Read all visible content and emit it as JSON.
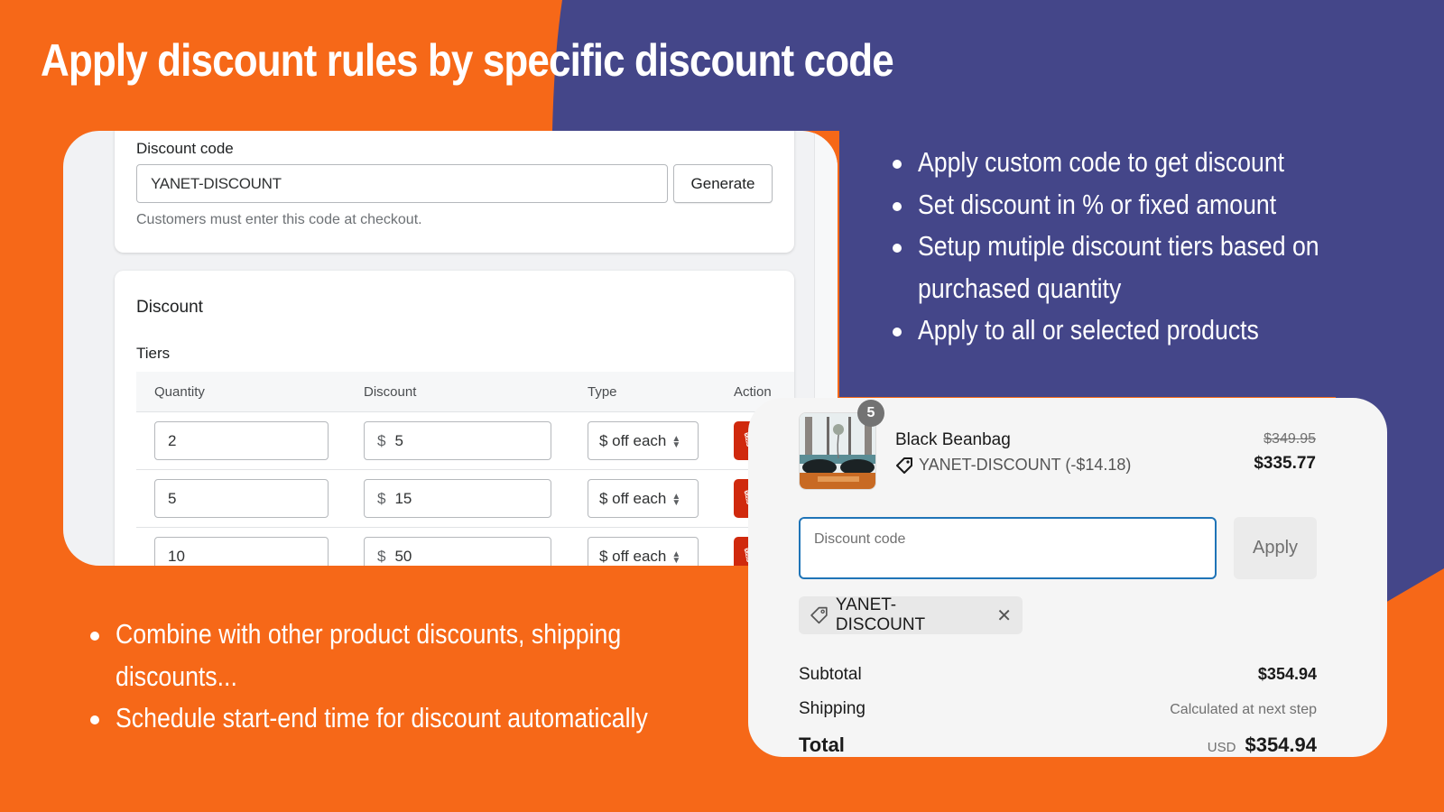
{
  "headline": "Apply discount rules by specific discount code",
  "colors": {
    "orange": "#f66818",
    "purple": "#444689",
    "danger": "#d0290d",
    "focus_blue": "#1f74b7"
  },
  "admin": {
    "code_card": {
      "label": "Discount code",
      "value": "YANET-DISCOUNT",
      "generate_label": "Generate",
      "helptext": "Customers must enter this code at checkout."
    },
    "discount_card": {
      "title": "Discount",
      "tiers_label": "Tiers",
      "columns": [
        "Quantity",
        "Discount",
        "Type",
        "Action"
      ],
      "rows": [
        {
          "quantity": "2",
          "currency": "$",
          "discount": "5",
          "type": "$ off each",
          "action_icon": "trash-icon"
        },
        {
          "quantity": "5",
          "currency": "$",
          "discount": "15",
          "type": "$ off each",
          "action_icon": "trash-icon"
        },
        {
          "quantity": "10",
          "currency": "$",
          "discount": "50",
          "type": "$ off each",
          "action_icon": "trash-icon"
        }
      ]
    }
  },
  "features_right": [
    "Apply custom code to get discount",
    "Set discount in % or fixed amount",
    "Setup mutiple discount tiers based on purchased quantity",
    "Apply to all or selected products"
  ],
  "features_left": [
    "Combine with other product discounts, shipping discounts...",
    "Schedule start-end time for discount automatically"
  ],
  "checkout": {
    "product": {
      "name": "Black Beanbag",
      "quantity_badge": "5",
      "code_line": "YANET-DISCOUNT (-$14.18)",
      "tag_icon": "tag-icon",
      "price_original": "$349.95",
      "price_discounted": "$335.77"
    },
    "discount_input_placeholder": "Discount code",
    "apply_label": "Apply",
    "applied_code": "YANET-DISCOUNT",
    "subtotal_label": "Subtotal",
    "subtotal_value": "$354.94",
    "shipping_label": "Shipping",
    "shipping_value": "Calculated at next step",
    "total_label": "Total",
    "total_currency": "USD",
    "total_value": "$354.94"
  }
}
